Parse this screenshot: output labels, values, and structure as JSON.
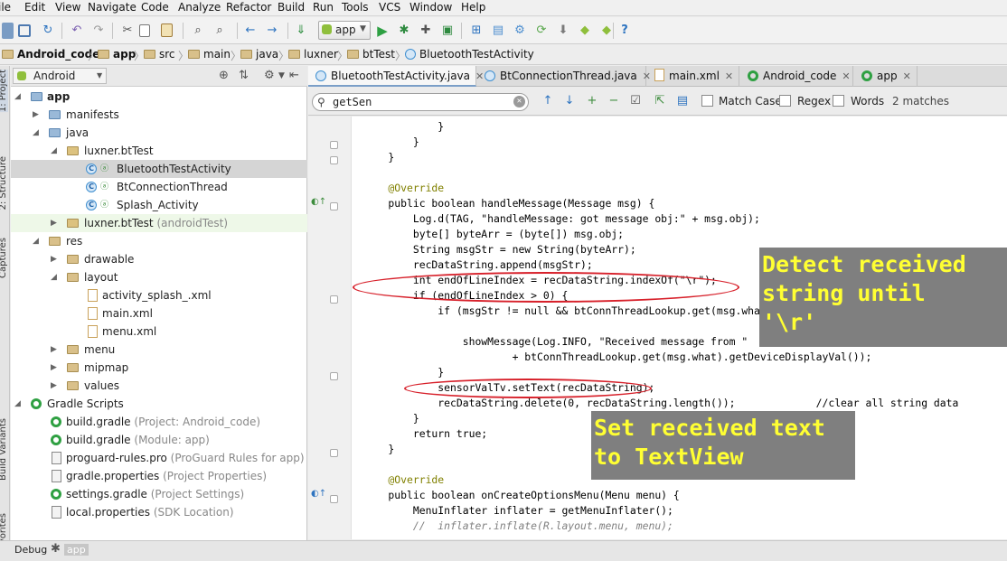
{
  "menu": [
    "ile",
    "Edit",
    "View",
    "Navigate",
    "Code",
    "Analyze",
    "Refactor",
    "Build",
    "Run",
    "Tools",
    "VCS",
    "Window",
    "Help"
  ],
  "toolbar": {
    "run_config": "app",
    "help_icon": "?"
  },
  "breadcrumb": [
    "Android_code",
    "app",
    "src",
    "main",
    "java",
    "luxner",
    "btTest",
    "BluetoothTestActivity"
  ],
  "left_strip": {
    "project": "1: Project",
    "structure": "2: Structure",
    "captures": "Captures",
    "build_variants": "Build Variants",
    "favorites": "Favorites"
  },
  "project_panel": {
    "view": "Android",
    "tree": [
      {
        "label": "app",
        "sub": ""
      },
      {
        "label": "manifests",
        "sub": ""
      },
      {
        "label": "java",
        "sub": ""
      },
      {
        "label": "luxner.btTest",
        "sub": ""
      },
      {
        "label": "BluetoothTestActivity",
        "sub": ""
      },
      {
        "label": "BtConnectionThread",
        "sub": ""
      },
      {
        "label": "Splash_Activity",
        "sub": ""
      },
      {
        "label": "luxner.btTest",
        "sub": "(androidTest)"
      },
      {
        "label": "res",
        "sub": ""
      },
      {
        "label": "drawable",
        "sub": ""
      },
      {
        "label": "layout",
        "sub": ""
      },
      {
        "label": "activity_splash_.xml",
        "sub": ""
      },
      {
        "label": "main.xml",
        "sub": ""
      },
      {
        "label": "menu.xml",
        "sub": ""
      },
      {
        "label": "menu",
        "sub": ""
      },
      {
        "label": "mipmap",
        "sub": ""
      },
      {
        "label": "values",
        "sub": ""
      },
      {
        "label": "Gradle Scripts",
        "sub": ""
      },
      {
        "label": "build.gradle",
        "sub": "(Project: Android_code)"
      },
      {
        "label": "build.gradle",
        "sub": "(Module: app)"
      },
      {
        "label": "proguard-rules.pro",
        "sub": "(ProGuard Rules for app)"
      },
      {
        "label": "gradle.properties",
        "sub": "(Project Properties)"
      },
      {
        "label": "settings.gradle",
        "sub": "(Project Settings)"
      },
      {
        "label": "local.properties",
        "sub": "(SDK Location)"
      }
    ]
  },
  "editor_tabs": [
    "BluetoothTestActivity.java",
    "BtConnectionThread.java",
    "main.xml",
    "Android_code",
    "app"
  ],
  "search": {
    "value": "getSen",
    "match_case": "Match Case",
    "regex": "Regex",
    "words": "Words",
    "matches": "2 matches"
  },
  "code": [
    "            }",
    "        }",
    "    }",
    "",
    "    @Override",
    "    public boolean handleMessage(Message msg) {",
    "        Log.d(TAG, \"handleMessage: got message obj:\" + msg.obj);",
    "        byte[] byteArr = (byte[]) msg.obj;",
    "        String msgStr = new String(byteArr);",
    "        recDataString.append(msgStr);",
    "        int endOfLineIndex = recDataString.indexOf(\"\\r\");",
    "        if (endOfLineIndex > 0) {",
    "            if (msgStr != null && btConnThreadLookup.get(msg.what)",
    "",
    "                showMessage(Log.INFO, \"Received message from \"",
    "                        + btConnThreadLookup.get(msg.what).getDeviceDisplayVal());",
    "            }",
    "            sensorValTv.setText(recDataString);",
    "            recDataString.delete(0, recDataString.length());             //clear all string data",
    "        }",
    "        return true;",
    "    }",
    "",
    "    @Override",
    "    public boolean onCreateOptionsMenu(Menu menu) {",
    "        MenuInflater inflater = getMenuInflater();",
    "        //  inflater.inflate(R.layout.menu, menu);"
  ],
  "callouts": {
    "detect": "Detect received\nstring until\n'\\r'",
    "settext": "Set received text\nto TextView"
  },
  "bottom": {
    "debug": "Debug",
    "app": "app"
  },
  "colors": {
    "callout_bg": "#7f7f7f",
    "callout_text": "#ffff33",
    "ellipse": "#d7202a"
  }
}
